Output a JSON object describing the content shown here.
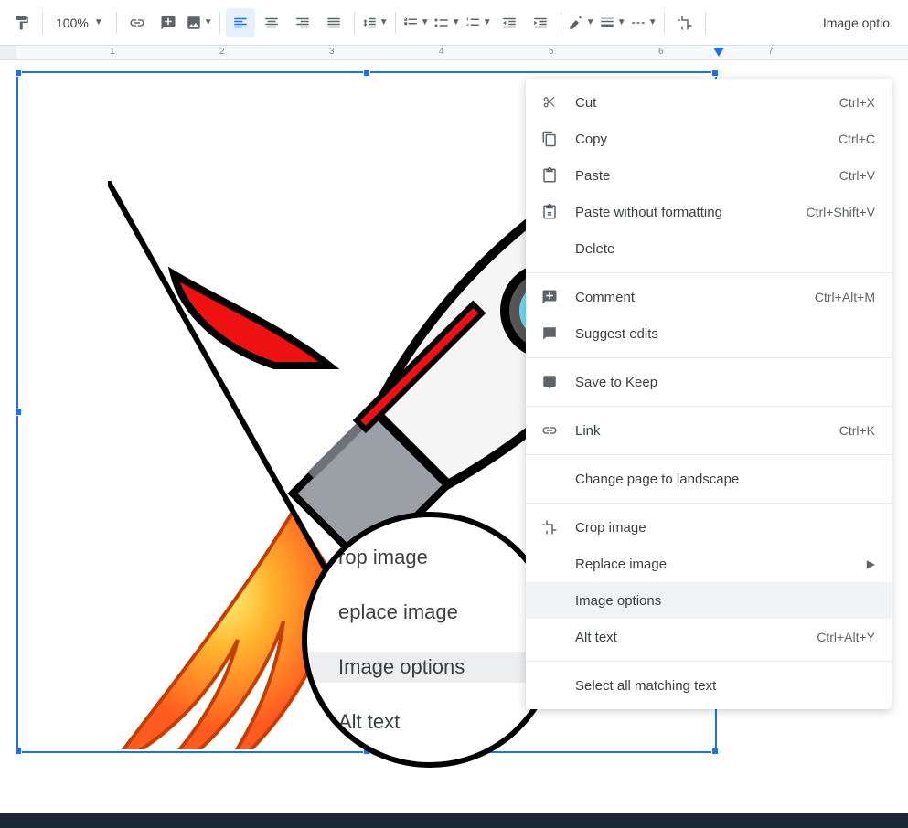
{
  "toolbar": {
    "zoom": "100%",
    "image_options_label": "Image optio"
  },
  "ruler": {
    "numbers": [
      "1",
      "2",
      "3",
      "4",
      "5",
      "6",
      "7"
    ]
  },
  "context_menu": {
    "cut": {
      "label": "Cut",
      "shortcut": "Ctrl+X"
    },
    "copy": {
      "label": "Copy",
      "shortcut": "Ctrl+C"
    },
    "paste": {
      "label": "Paste",
      "shortcut": "Ctrl+V"
    },
    "paste_without": {
      "label": "Paste without formatting",
      "shortcut": "Ctrl+Shift+V"
    },
    "delete": {
      "label": "Delete"
    },
    "comment": {
      "label": "Comment",
      "shortcut": "Ctrl+Alt+M"
    },
    "suggest": {
      "label": "Suggest edits"
    },
    "save_keep": {
      "label": "Save to Keep"
    },
    "link": {
      "label": "Link",
      "shortcut": "Ctrl+K"
    },
    "landscape": {
      "label": "Change page to landscape"
    },
    "crop": {
      "label": "Crop image"
    },
    "replace": {
      "label": "Replace image"
    },
    "image_options": {
      "label": "Image options"
    },
    "alt_text": {
      "label": "Alt text",
      "shortcut": "Ctrl+Alt+Y"
    },
    "select_all": {
      "label": "Select all matching text"
    }
  },
  "magnifier": {
    "crop": "rop image",
    "replace": "eplace image",
    "image_options": "Image options",
    "alt_text": "Alt text"
  }
}
